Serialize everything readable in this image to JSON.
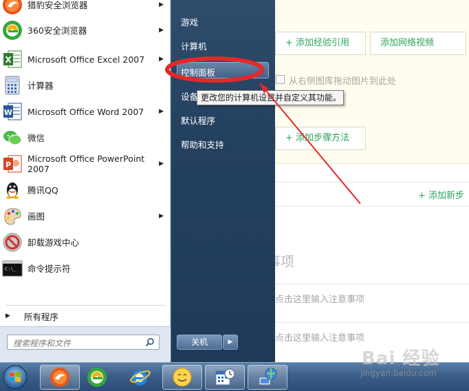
{
  "background_page": {
    "buttons": {
      "add_experience_ref": "+ 添加经验引用",
      "add_network_video": "添加网络视频",
      "add_step_method": "+ 添加步骤方法",
      "add_new_step": "+ 添加新步"
    },
    "drag_hint": "从右侧图库拖动图片到此处",
    "notes_section_title": "注意事项",
    "note_placeholder_1": "点击这里输入注意事项",
    "note_placeholder_2": "点击这里输入注意事项"
  },
  "start_menu": {
    "programs": [
      {
        "label": "猎豹安全浏览器",
        "icon": "cheetah-browser-icon",
        "has_arrow": true
      },
      {
        "label": "360安全浏览器",
        "icon": "360-browser-icon",
        "has_arrow": true
      },
      {
        "label": "Microsoft Office Excel 2007",
        "icon": "excel-icon",
        "has_arrow": true
      },
      {
        "label": "计算器",
        "icon": "calculator-icon",
        "has_arrow": false
      },
      {
        "label": "Microsoft Office Word 2007",
        "icon": "word-icon",
        "has_arrow": true
      },
      {
        "label": "微信",
        "icon": "wechat-icon",
        "has_arrow": false
      },
      {
        "label": "Microsoft Office PowerPoint 2007",
        "icon": "powerpoint-icon",
        "has_arrow": true
      },
      {
        "label": "腾讯QQ",
        "icon": "qq-icon",
        "has_arrow": false
      },
      {
        "label": "画图",
        "icon": "paint-icon",
        "has_arrow": true
      },
      {
        "label": "卸载游戏中心",
        "icon": "uninstall-game-icon",
        "has_arrow": false
      },
      {
        "label": "命令提示符",
        "icon": "cmd-icon",
        "has_arrow": false
      }
    ],
    "all_programs": "所有程序",
    "search_placeholder": "搜索程序和文件",
    "right_items": {
      "games": "游戏",
      "computer": "计算机",
      "control_panel": "控制面板",
      "devices": "设备",
      "default_programs": "默认程序",
      "help_support": "帮助和支持"
    },
    "shutdown_label": "关机",
    "tooltip": "更改您的计算机设置并自定义其功能。"
  },
  "taskbar": {
    "items": [
      "cheetah-browser-icon",
      "360-browser-icon",
      "ie-icon",
      "emoticon-icon",
      "calendar-clock-icon",
      "network-globe-icon"
    ]
  },
  "watermark": {
    "logo": "Bai 经验",
    "url": "jingyan.baidu.com"
  },
  "colors": {
    "accent_green": "#2ea15b",
    "annotation_red": "#e62828",
    "start_menu_right": "#24405f"
  }
}
